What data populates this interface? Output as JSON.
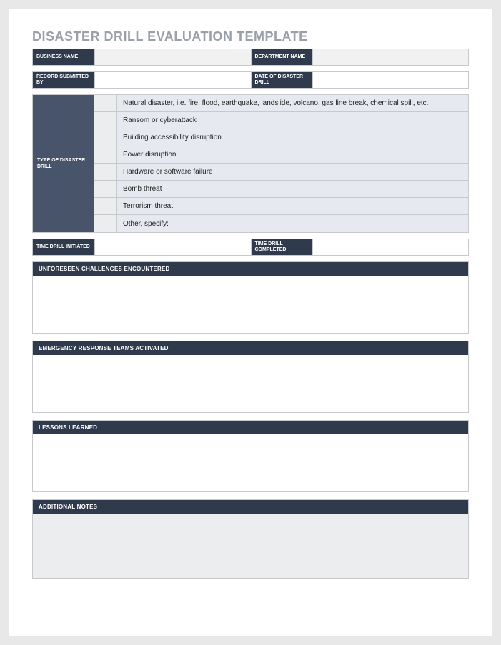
{
  "title": "DISASTER DRILL EVALUATION TEMPLATE",
  "row1": {
    "label1": "BUSINESS NAME",
    "label2": "DEPARTMENT NAME"
  },
  "row2": {
    "label1": "RECORD SUBMITTED BY",
    "label2": "DATE OF DISASTER DRILL"
  },
  "drill": {
    "label": "TYPE OF DISASTER DRILL",
    "options": [
      "Natural disaster, i.e. fire, flood, earthquake, landslide, volcano, gas line break, chemical spill, etc.",
      "Ransom or cyberattack",
      "Building accessibility disruption",
      "Power disruption",
      "Hardware or software failure",
      "Bomb threat",
      "Terrorism threat",
      "Other, specify:"
    ]
  },
  "row3": {
    "label1": "TIME DRILL INITIATED",
    "label2": "TIME DRILL COMPLETED"
  },
  "sections": {
    "s1": "UNFORESEEN CHALLENGES ENCOUNTERED",
    "s2": "EMERGENCY RESPONSE TEAMS ACTIVATED",
    "s3": "LESSONS LEARNED",
    "s4": "ADDITIONAL NOTES"
  }
}
